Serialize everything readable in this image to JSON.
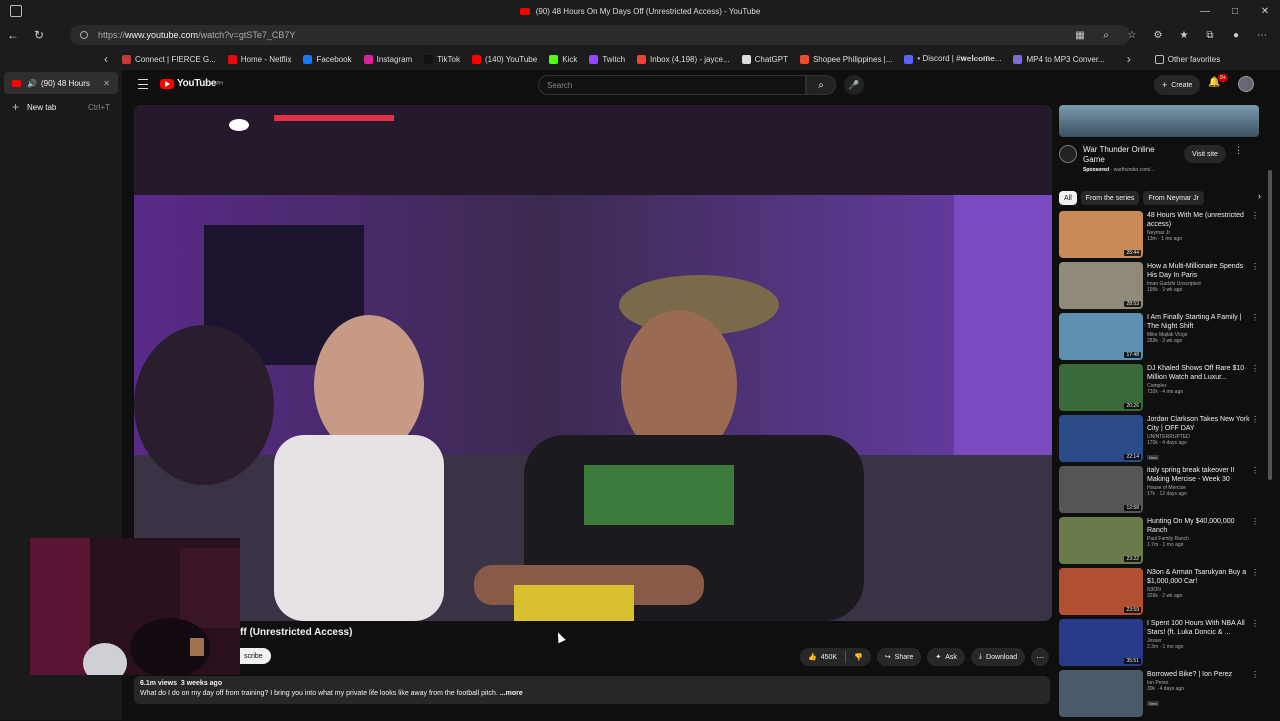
{
  "window": {
    "title": "(90) 48 Hours On My Days Off (Unrestricted Access) - YouTube",
    "controls": [
      "—",
      "□",
      "✕"
    ]
  },
  "browser": {
    "url_prefix": "https://",
    "url_host": "www.youtube.com",
    "url_path": "/watch?v=gtSTe7_CB7Y",
    "favorites": [
      {
        "label": "Connect | FIERCE G...",
        "color": "#c23b3b"
      },
      {
        "label": "Home - Netflix",
        "color": "#e50914"
      },
      {
        "label": "Facebook",
        "color": "#1877f2"
      },
      {
        "label": "Instagram",
        "color": "#d6249f"
      },
      {
        "label": "TikTok",
        "color": "#111111"
      },
      {
        "label": "(140) YouTube",
        "color": "#ff0000"
      },
      {
        "label": "Kick",
        "color": "#53fc18"
      },
      {
        "label": "Twitch",
        "color": "#9146ff"
      },
      {
        "label": "Inbox (4,198) - jayce...",
        "color": "#ea4335"
      },
      {
        "label": "ChatGPT",
        "color": "#dddddd"
      },
      {
        "label": "Shopee Philippines |...",
        "color": "#ee4d2d"
      },
      {
        "label": "• Discord | #𝐰𝐞𝐥𝐜𝐨𝐦𝐞...",
        "color": "#5865f2"
      },
      {
        "label": "MP4 to MP3 Conver...",
        "color": "#7c6cd8"
      }
    ],
    "other_favorites": "Other favorites",
    "tabs": [
      {
        "label": "(90) 48 Hours",
        "active": true
      },
      {
        "label": "New tab",
        "shortcut": "Ctrl+T",
        "active": false
      }
    ]
  },
  "youtube": {
    "logo_text": "YouTube",
    "logo_sup": "PH",
    "search_placeholder": "Search",
    "create_label": "Create",
    "notif_count": "9+",
    "video_title_visible": "ff (Unrestricted Access)",
    "subscribe_label": "scribe",
    "likes": "450K",
    "share_label": "Share",
    "ask_label": "Ask",
    "download_label": "Download",
    "views": "6.1m views",
    "posted": "3 weeks ago",
    "description": "What do I do on my day off from training? I bring you into what my private life looks like away from the football pitch.",
    "more_label": "...more"
  },
  "ad": {
    "title": "War Thunder Online Game",
    "sponsored": "Sponsored",
    "domain": "warthunder.com/...",
    "visit_label": "Visit site"
  },
  "chips": [
    "All",
    "From the series",
    "From Neymar Jr"
  ],
  "recommendations": [
    {
      "title": "48 Hours With Me (unrestricted access)",
      "channel": "Neymar Jr",
      "meta": "13m · 1 mo ago",
      "duration": "26:44",
      "bg": "#c98a5a",
      "new": false
    },
    {
      "title": "How a Multi-Millionaire Spends His Day In Paris",
      "channel": "Iman Gadzhi Unscripted",
      "meta": "195k · 3 wk ago",
      "duration": "28:53",
      "bg": "#8f8a7a",
      "new": false
    },
    {
      "title": "I Am Finally Starting A Family | The Night Shift",
      "channel": "Mike Majlak Vlogs",
      "meta": "283k · 3 wk ago",
      "duration": "17:48",
      "bg": "#5d8fb0",
      "new": false
    },
    {
      "title": "DJ Khaled Shows Off Rare $10 Million Watch and Luxur...",
      "channel": "Complex",
      "meta": "732k · 4 mo ago",
      "duration": "20:26",
      "bg": "#3a6a3a",
      "new": false
    },
    {
      "title": "Jordan Clarkson Takes New York City | OFF DAY",
      "channel": "UNINTERRUPTED",
      "meta": "170k · 4 days ago",
      "duration": "22:14",
      "bg": "#2a4a8a",
      "new": true
    },
    {
      "title": "italy spring break takeover II Making Mercise - Week 30",
      "channel": "House of Mercise",
      "meta": "17k · 12 days ago",
      "duration": "12:58",
      "bg": "#555555",
      "new": false
    },
    {
      "title": "Hunting On My $40,000,000 Ranch",
      "channel": "Paul Family Ranch",
      "meta": "1.7m · 1 mo ago",
      "duration": "23:22",
      "bg": "#6a7a4a",
      "new": false
    },
    {
      "title": "N3on & Arman Tsarukyan Buy a $1,000,000 Car!",
      "channel": "N3ON",
      "meta": "326k · 2 wk ago",
      "duration": "23:59",
      "bg": "#b05030",
      "new": false
    },
    {
      "title": "I Spent 100 Hours With NBA All Stars! (ft. Luka Doncic & ...",
      "channel": "Jesser",
      "meta": "2.3m · 1 mo ago",
      "duration": "35:51",
      "bg": "#2a3a8a",
      "new": false
    },
    {
      "title": "Borrowed Bike? | Ion Perez",
      "channel": "Ion Perez",
      "meta": "30k · 4 days ago",
      "duration": "",
      "bg": "#4a5a6a",
      "new": true
    }
  ]
}
